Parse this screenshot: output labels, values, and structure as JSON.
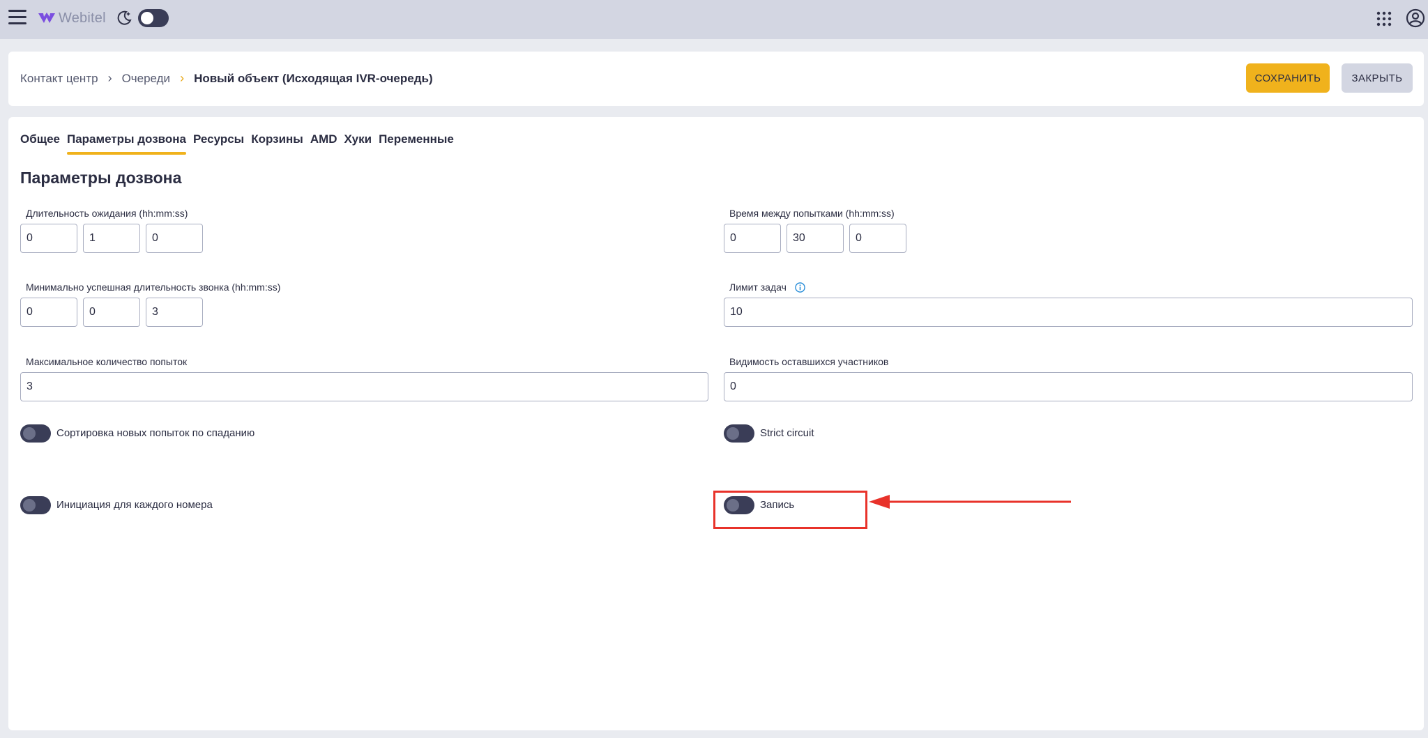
{
  "topbar": {
    "logo_text": "Webitel",
    "icons": [
      "menu-icon",
      "logo-icon",
      "moon-icon",
      "apps-grid-icon",
      "account-icon"
    ],
    "theme_toggle_on": false
  },
  "header": {
    "breadcrumb": [
      "Контакт центр",
      "Очереди",
      "Новый объект (Исходящая IVR-очередь)"
    ],
    "save_label": "СОХРАНИТЬ",
    "close_label": "ЗАКРЫТЬ"
  },
  "tabs": [
    "Общее",
    "Параметры дозвона",
    "Ресурсы",
    "Корзины",
    "AMD",
    "Хуки",
    "Переменные"
  ],
  "active_tab": "Параметры дозвона",
  "section_title": "Параметры дозвона",
  "fields": {
    "wait_duration": {
      "label": "Длительность ожидания (hh:mm:ss)",
      "h": "0",
      "m": "1",
      "s": "0"
    },
    "retry_interval": {
      "label": "Время между попытками (hh:mm:ss)",
      "h": "0",
      "m": "30",
      "s": "0"
    },
    "min_success_duration": {
      "label": "Минимально успешная длительность звонка (hh:mm:ss)",
      "h": "0",
      "m": "0",
      "s": "3"
    },
    "task_limit": {
      "label": "Лимит задач",
      "value": "10"
    },
    "max_attempts": {
      "label": "Максимальное количество попыток",
      "value": "3"
    },
    "remaining_visibility": {
      "label": "Видимость оставшихся участников",
      "value": "0"
    }
  },
  "toggles": {
    "sort_desc": {
      "label": "Сортировка новых попыток по спаданию",
      "on": false
    },
    "strict_circuit": {
      "label": "Strict circuit",
      "on": false
    },
    "per_number_init": {
      "label": "Инициация для каждого номера",
      "on": false
    },
    "recording": {
      "label": "Запись",
      "on": false
    }
  },
  "colors": {
    "accent": "#f0b21c",
    "topbar": "#d3d6e2",
    "toggle": "#3a3d57",
    "annotation": "#e8322a"
  }
}
